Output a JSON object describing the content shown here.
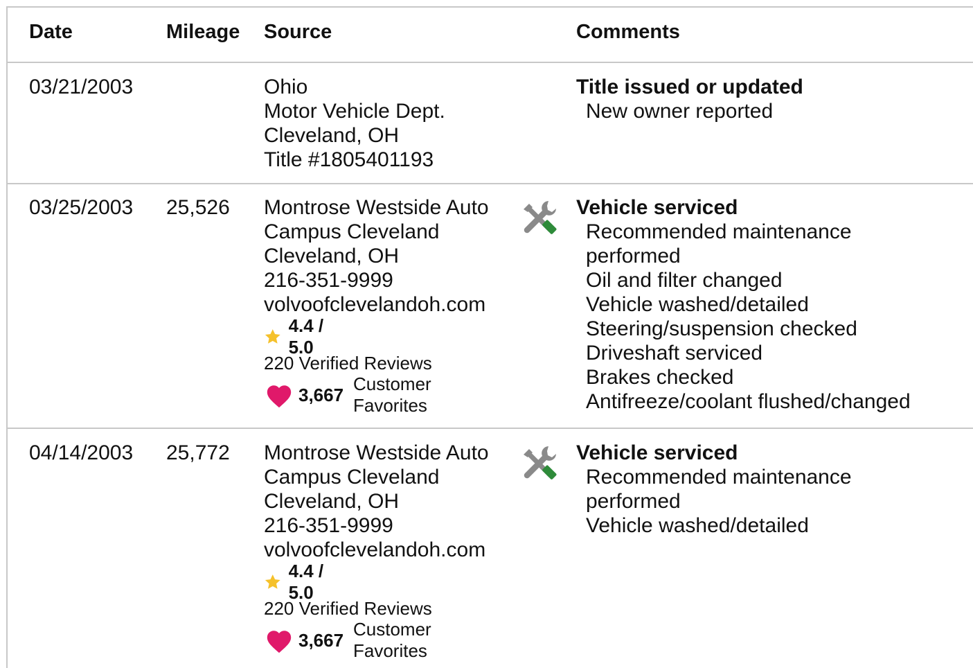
{
  "headers": {
    "date": "Date",
    "mileage": "Mileage",
    "source": "Source",
    "comments": "Comments"
  },
  "rows": [
    {
      "date": "03/21/2003",
      "mileage": "",
      "source": [
        "Ohio",
        "Motor Vehicle Dept.",
        "Cleveland, OH",
        "Title #1805401193"
      ],
      "comment_title": "Title issued or updated",
      "comment_lines": [
        "New owner reported"
      ]
    },
    {
      "date": "03/25/2003",
      "mileage": "25,526",
      "source": [
        "Montrose Westside Auto",
        "Campus Cleveland",
        "Cleveland, OH",
        "216-351-9999",
        "volvoofclevelandoh.com"
      ],
      "rating": "4.4 / 5.0",
      "reviews": "220 Verified Reviews",
      "favorites_count": "3,667",
      "favorites_label": [
        "Customer",
        "Favorites"
      ],
      "service_icon": "wrench-screwdriver-icon",
      "comment_title": "Vehicle serviced",
      "comment_lines": [
        "Recommended maintenance",
        "performed",
        "Oil and filter changed",
        "Vehicle washed/detailed",
        "Steering/suspension checked",
        "Driveshaft serviced",
        "Brakes checked",
        "Antifreeze/coolant flushed/changed"
      ]
    },
    {
      "date": "04/14/2003",
      "mileage": "25,772",
      "source": [
        "Montrose Westside Auto",
        "Campus Cleveland",
        "Cleveland, OH",
        "216-351-9999",
        "volvoofclevelandoh.com"
      ],
      "rating": "4.4 / 5.0",
      "reviews": "220 Verified Reviews",
      "favorites_count": "3,667",
      "favorites_label": [
        "Customer",
        "Favorites"
      ],
      "service_icon": "wrench-screwdriver-icon",
      "comment_title": "Vehicle serviced",
      "comment_lines": [
        "Recommended maintenance",
        "performed",
        "Vehicle washed/detailed"
      ]
    }
  ],
  "colors": {
    "star": "#f5c12b",
    "heart": "#e0196a",
    "screwdriver": "#2e8b3a",
    "wrench": "#8a8a8a",
    "divider": "#c8c8c8"
  }
}
